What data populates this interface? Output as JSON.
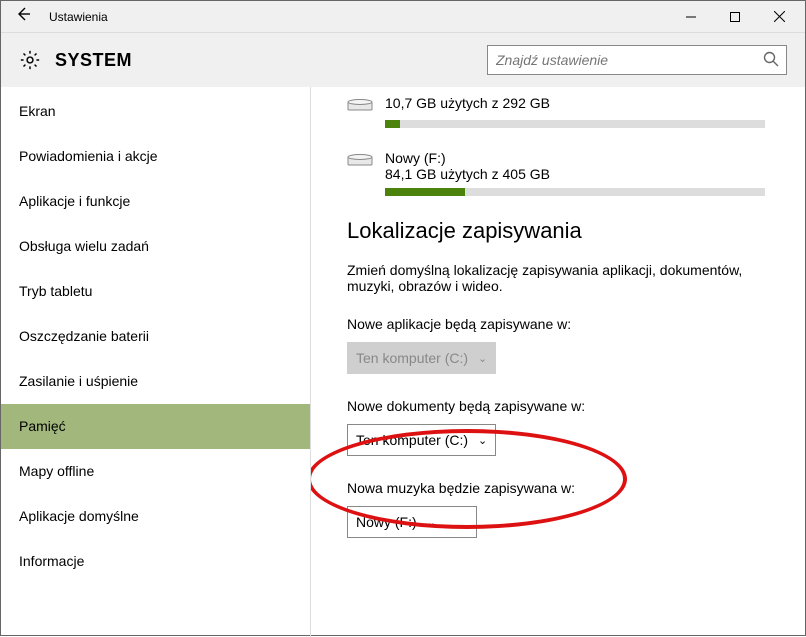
{
  "window": {
    "title": "Ustawienia"
  },
  "header": {
    "system_label": "SYSTEM",
    "search_placeholder": "Znajdź ustawienie"
  },
  "sidebar": {
    "items": [
      "Ekran",
      "Powiadomienia i akcje",
      "Aplikacje i funkcje",
      "Obsługa wielu zadań",
      "Tryb tabletu",
      "Oszczędzanie baterii",
      "Zasilanie i uśpienie",
      "Pamięć",
      "Mapy offline",
      "Aplikacje domyślne",
      "Informacje"
    ],
    "active_index": 7
  },
  "drives": [
    {
      "name": "",
      "usage": "10,7 GB użytych z 292 GB",
      "percent": 4
    },
    {
      "name": "Nowy (F:)",
      "usage": "84,1 GB użytych z 405 GB",
      "percent": 21
    }
  ],
  "save_locations": {
    "heading": "Lokalizacje zapisywania",
    "description": "Zmień domyślną lokalizację zapisywania aplikacji, dokumentów, muzyki, obrazów i wideo.",
    "fields": [
      {
        "label": "Nowe aplikacje będą zapisywane w:",
        "value": "Ten komputer (C:)",
        "disabled": true
      },
      {
        "label": "Nowe dokumenty będą zapisywane w:",
        "value": "Ten komputer (C:)",
        "disabled": false
      },
      {
        "label": "Nowa muzyka będzie zapisywana w:",
        "value": "Nowy (F:)",
        "disabled": false
      }
    ]
  }
}
